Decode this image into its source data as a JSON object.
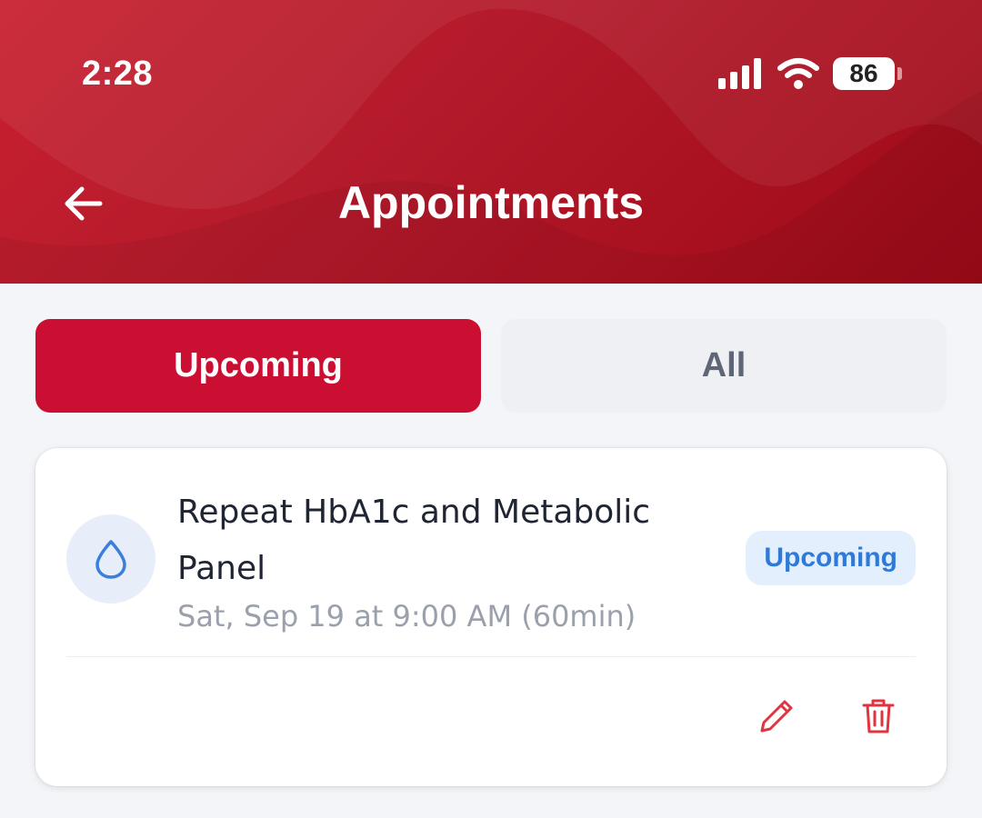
{
  "status_bar": {
    "time": "2:28",
    "battery": "86",
    "icons": [
      "signal-icon",
      "wifi-icon",
      "battery-icon"
    ]
  },
  "header": {
    "title": "Appointments",
    "back_icon": "arrow-left-icon",
    "color": "#b81a2b"
  },
  "tabs": [
    {
      "label": "Upcoming",
      "active": true
    },
    {
      "label": "All",
      "active": false
    }
  ],
  "appointments": [
    {
      "title": "Repeat HbA1c and Metabolic Panel",
      "datetime": "Sat, Sep 19 at 9:00 AM (60min)",
      "status": "Upcoming",
      "icon": "drop-icon",
      "actions": [
        "pencil-icon",
        "trash-icon"
      ]
    }
  ],
  "colors": {
    "accent": "#cb0f32",
    "badge_text": "#2f7ad9",
    "badge_bg": "#e3effc",
    "action": "#e0353f"
  }
}
